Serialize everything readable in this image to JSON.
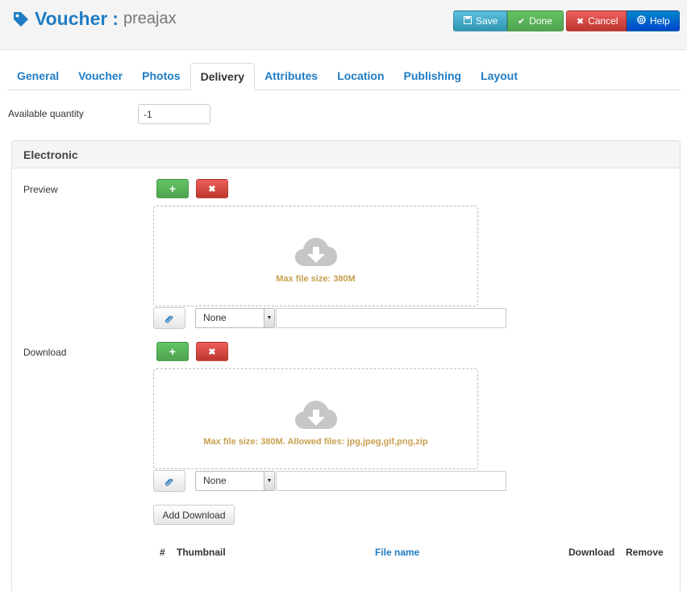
{
  "header": {
    "title": "Voucher",
    "separator": ":",
    "subtitle": "preajax",
    "icon": "tag-icon"
  },
  "toolbar": {
    "save": "Save",
    "done": "Done",
    "cancel": "Cancel",
    "help": "Help"
  },
  "tabs": [
    "General",
    "Voucher",
    "Photos",
    "Delivery",
    "Attributes",
    "Location",
    "Publishing",
    "Layout"
  ],
  "active_tab": "Delivery",
  "available_quantity": {
    "label": "Available quantity",
    "value": "-1"
  },
  "electronic": {
    "title": "Electronic",
    "preview": {
      "label": "Preview",
      "add_symbol": "+",
      "remove_symbol": "✖",
      "drop_message": "Max file size: 380M",
      "select_value": "None"
    },
    "download": {
      "label": "Download",
      "add_symbol": "+",
      "remove_symbol": "✖",
      "drop_message": "Max file size: 380M. Allowed files: jpg,jpeg,gif,png,zip",
      "select_value": "None"
    },
    "add_download": "Add Download",
    "table_headers": {
      "num": "#",
      "thumbnail": "Thumbnail",
      "file_name": "File name",
      "download": "Download",
      "remove": "Remove"
    }
  },
  "colors": {
    "accent": "#1f7cc4",
    "drop_text": "#c8a050"
  }
}
